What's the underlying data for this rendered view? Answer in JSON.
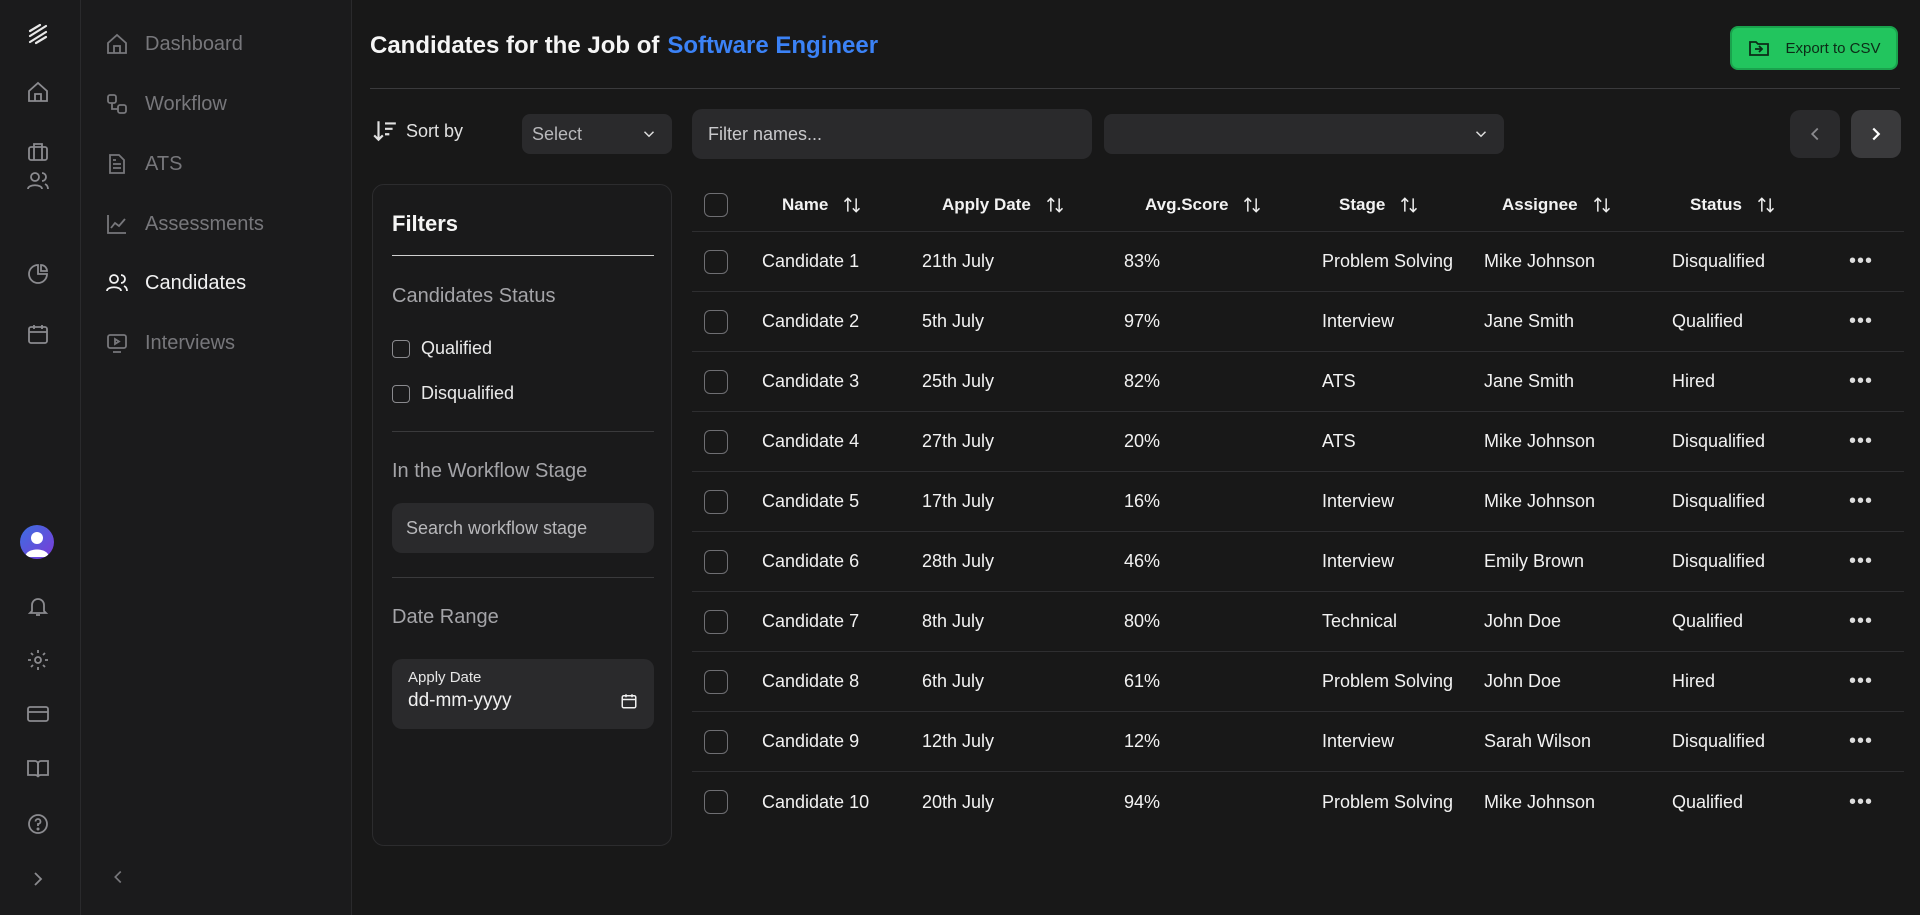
{
  "sidebar": {
    "items": [
      {
        "label": "Dashboard",
        "icon": "home-icon"
      },
      {
        "label": "Workflow",
        "icon": "workflow-icon"
      },
      {
        "label": "ATS",
        "icon": "document-icon"
      },
      {
        "label": "Assessments",
        "icon": "chart-line-icon"
      },
      {
        "label": "Candidates",
        "icon": "users-icon",
        "active": true
      },
      {
        "label": "Interviews",
        "icon": "video-icon"
      }
    ]
  },
  "header": {
    "title_prefix": "Candidates for the Job of",
    "job_title": "Software Engineer",
    "export_label": "Export to CSV"
  },
  "toolbar": {
    "sort_label": "Sort by",
    "sort_select_value": "Select",
    "filter_placeholder": "Filter names...",
    "second_dropdown_value": ""
  },
  "filters": {
    "title": "Filters",
    "status_heading": "Candidates Status",
    "status_options": [
      "Qualified",
      "Disqualified"
    ],
    "stage_heading": "In the Workflow Stage",
    "stage_placeholder": "Search workflow stage",
    "date_heading": "Date Range",
    "date_label": "Apply Date",
    "date_placeholder": "dd-mm-yyyy"
  },
  "table": {
    "headers": [
      "Name",
      "Apply Date",
      "Avg.Score",
      "Stage",
      "Assignee",
      "Status"
    ],
    "rows": [
      [
        "Candidate 1",
        "21th July",
        "83%",
        "Problem Solving",
        "Mike Johnson",
        "Disqualified"
      ],
      [
        "Candidate 2",
        "5th July",
        "97%",
        "Interview",
        "Jane Smith",
        "Qualified"
      ],
      [
        "Candidate 3",
        "25th July",
        "82%",
        "ATS",
        "Jane Smith",
        "Hired"
      ],
      [
        "Candidate 4",
        "27th July",
        "20%",
        "ATS",
        "Mike Johnson",
        "Disqualified"
      ],
      [
        "Candidate 5",
        "17th July",
        "16%",
        "Interview",
        "Mike Johnson",
        "Disqualified"
      ],
      [
        "Candidate 6",
        "28th July",
        "46%",
        "Interview",
        "Emily Brown",
        "Disqualified"
      ],
      [
        "Candidate 7",
        "8th July",
        "80%",
        "Technical",
        "John Doe",
        "Qualified"
      ],
      [
        "Candidate 8",
        "6th July",
        "61%",
        "Problem Solving",
        "John Doe",
        "Hired"
      ],
      [
        "Candidate 9",
        "12th July",
        "12%",
        "Interview",
        "Sarah Wilson",
        "Disqualified"
      ],
      [
        "Candidate 10",
        "20th July",
        "94%",
        "Problem Solving",
        "Mike Johnson",
        "Qualified"
      ]
    ]
  },
  "colors": {
    "accent": "#3b82f6",
    "export_bg": "#22c55e",
    "background": "#181818",
    "panel": "#2a2a2c"
  }
}
